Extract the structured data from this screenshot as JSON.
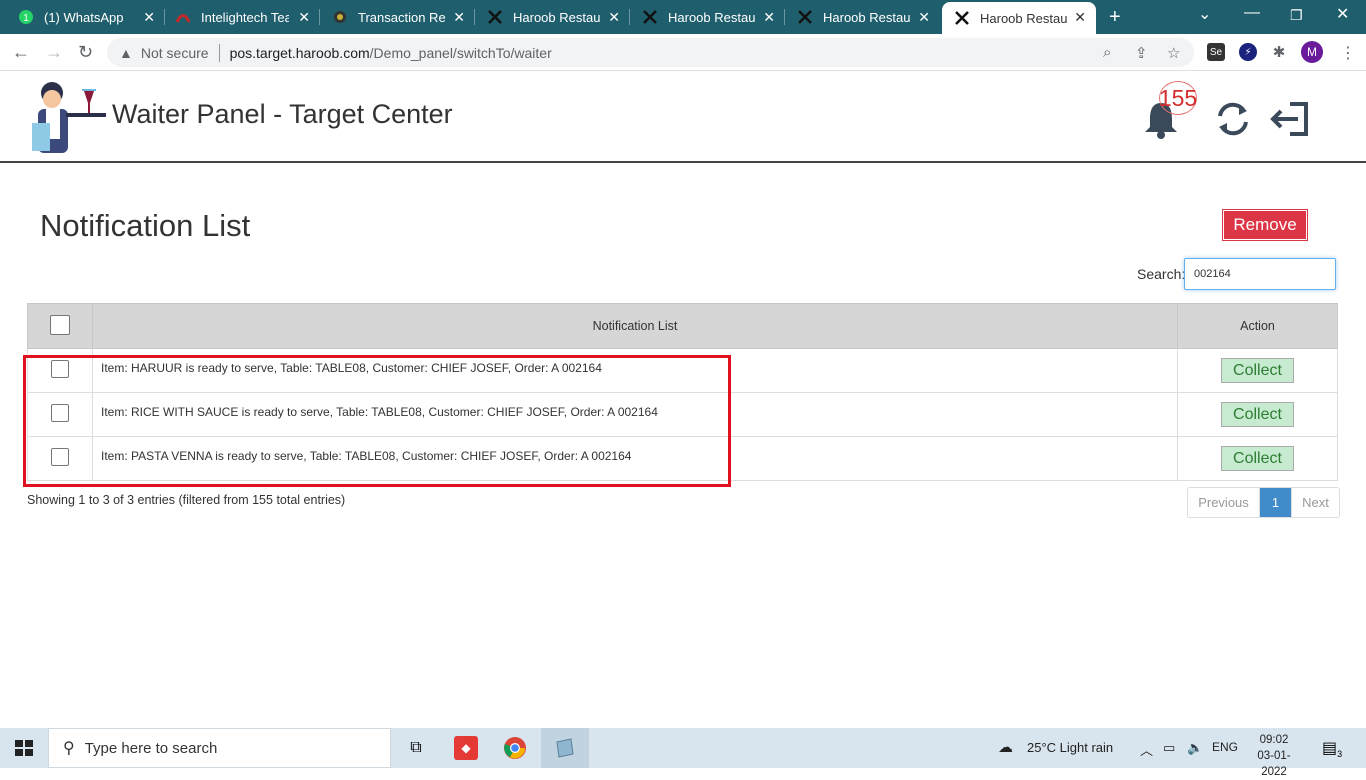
{
  "browser": {
    "tabs": [
      {
        "title": "(1) WhatsApp",
        "favicon": "whatsapp-icon"
      },
      {
        "title": "Intelightech Team",
        "favicon": "intelightech-icon"
      },
      {
        "title": "Transaction Repo",
        "favicon": "transaction-icon"
      },
      {
        "title": "Haroob Restaura",
        "favicon": "x-icon"
      },
      {
        "title": "Haroob Restaura",
        "favicon": "x-icon"
      },
      {
        "title": "Haroob Restaura",
        "favicon": "x-icon"
      },
      {
        "title": "Haroob Restaura",
        "favicon": "x-icon",
        "active": true
      }
    ],
    "security_label": "Not secure",
    "url_host": "pos.target.haroob.com",
    "url_path": "/Demo_panel/switchTo/waiter",
    "profile_initial": "M"
  },
  "header": {
    "title": "Waiter Panel - Target Center",
    "notification_count": "155"
  },
  "main": {
    "heading": "Notification List",
    "remove_label": "Remove",
    "search_label": "Search:",
    "search_value": "002164",
    "table": {
      "columns": [
        "Notification List",
        "Action"
      ],
      "rows": [
        {
          "message": "Item: HARUUR is ready to serve, Table: TABLE08, Customer: CHIEF JOSEF, Order: A 002164",
          "action": "Collect"
        },
        {
          "message": "Item: RICE WITH SAUCE is ready to serve, Table: TABLE08, Customer: CHIEF JOSEF, Order: A 002164",
          "action": "Collect"
        },
        {
          "message": "Item: PASTA VENNA is ready to serve, Table: TABLE08, Customer: CHIEF JOSEF, Order: A 002164",
          "action": "Collect"
        }
      ]
    },
    "info": "Showing 1 to 3 of 3 entries (filtered from 155 total entries)",
    "pagination": {
      "previous": "Previous",
      "current": "1",
      "next": "Next"
    }
  },
  "taskbar": {
    "search_placeholder": "Type here to search",
    "weather": "25°C  Light rain",
    "language": "ENG",
    "time": "09:02",
    "date": "03-01-2022",
    "notification_count": "3"
  },
  "colors": {
    "remove": "#dc3545",
    "collect_bg": "#c6ebd0",
    "pager_active": "#428bca",
    "highlight": "#e0101e"
  }
}
